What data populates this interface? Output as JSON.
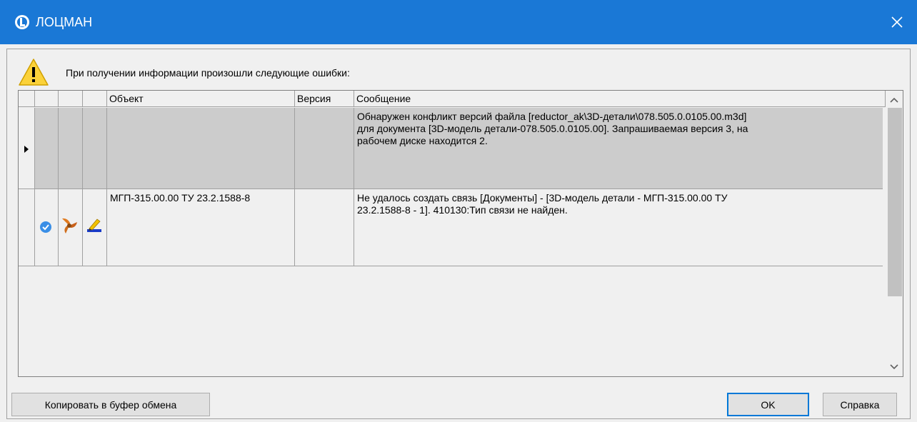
{
  "window": {
    "title": "ЛОЦМАН"
  },
  "dialog": {
    "message": "При получении информации произошли следующие ошибки:"
  },
  "table": {
    "columns": [
      "",
      "",
      "",
      "Объект",
      "Версия",
      "Сообщение"
    ],
    "rows": [
      {
        "selected": true,
        "object": "",
        "version": "",
        "message_lines": [
          "Обнаружен конфликт версий файла [reductor_ak\\3D-детали\\078.505.0.0105.00.m3d]",
          "для документа [3D-модель детали-078.505.0.0105.00]. Запрашиваемая версия 3, на",
          "рабочем диске находится 2."
        ]
      },
      {
        "selected": false,
        "object": "МГП-315.00.00 ТУ 23.2.1588-8",
        "version": "",
        "icons": [
          "checkmark-icon",
          "propeller-icon",
          "pencil-edit-icon"
        ],
        "message_lines": [
          "Не удалось создать связь [Документы] - [3D-модель детали - МГП-315.00.00 ТУ",
          "23.2.1588-8 - 1]. 410130:Тип связи не найден."
        ]
      }
    ]
  },
  "buttons": {
    "copy": "Копировать в буфер обмена",
    "ok": "OK",
    "help": "Справка"
  },
  "colors": {
    "titlebar": "#1a78d6",
    "selected_row": "#cccccc",
    "primary_border": "#0078d7"
  }
}
